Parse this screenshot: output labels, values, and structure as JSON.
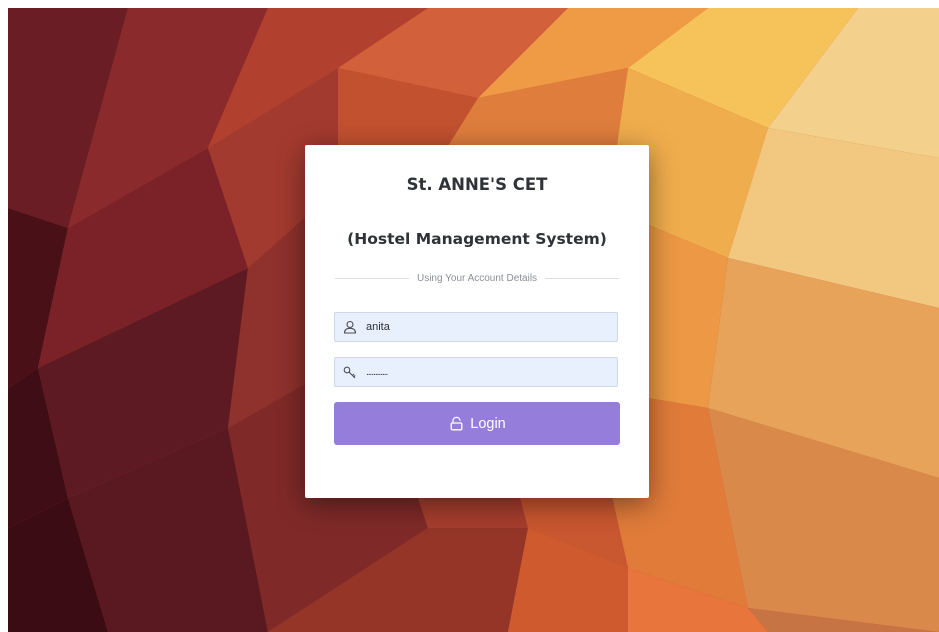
{
  "page": {
    "background_style": "low-poly geometric pattern",
    "colors": {
      "card_bg": "#ffffff",
      "input_bg": "#e8f0fe",
      "button_bg": "#957ddb",
      "title_text": "#2f3338",
      "divider_text": "#8a8f96"
    }
  },
  "login_card": {
    "title": "St. ANNE'S CET",
    "subtitle": "(Hostel Management System)",
    "divider_text": "Using Your Account Details",
    "username": {
      "icon": "user-icon",
      "value": "anita"
    },
    "password": {
      "icon": "key-icon",
      "value": "............"
    },
    "login_button": {
      "icon": "lock-icon",
      "label": "Login"
    }
  }
}
